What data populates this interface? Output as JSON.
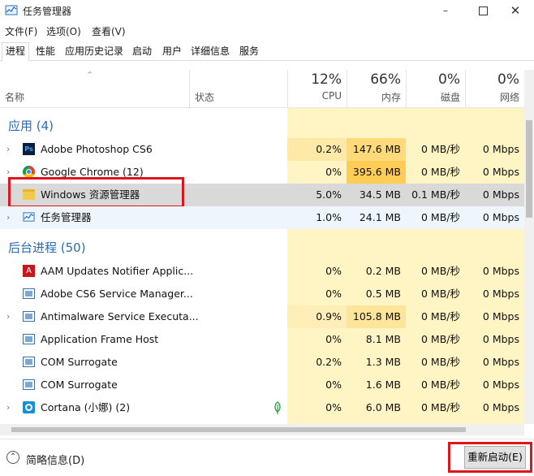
{
  "window": {
    "title": "任务管理器"
  },
  "menu": [
    "文件(F)",
    "选项(O)",
    "查看(V)"
  ],
  "tabs": [
    "进程",
    "性能",
    "应用历史记录",
    "启动",
    "用户",
    "详细信息",
    "服务"
  ],
  "columns": {
    "name": "名称",
    "status": "状态",
    "cpu": {
      "pct": "12%",
      "label": "CPU"
    },
    "memory": {
      "pct": "66%",
      "label": "内存"
    },
    "disk": {
      "pct": "0%",
      "label": "磁盘"
    },
    "network": {
      "pct": "0%",
      "label": "网络"
    }
  },
  "groups": {
    "apps": "应用 (4)",
    "background": "后台进程 (50)"
  },
  "apps": [
    {
      "name": "Adobe Photoshop CS6",
      "cpu": "0.2%",
      "mem": "147.6 MB",
      "disk": "0 MB/秒",
      "net": "0 Mbps"
    },
    {
      "name": "Google Chrome (12)",
      "cpu": "0%",
      "mem": "395.6 MB",
      "disk": "0 MB/秒",
      "net": "0 Mbps"
    },
    {
      "name": "Windows 资源管理器",
      "cpu": "5.0%",
      "mem": "34.5 MB",
      "disk": "0.1 MB/秒",
      "net": "0 Mbps"
    },
    {
      "name": "任务管理器",
      "cpu": "1.0%",
      "mem": "24.1 MB",
      "disk": "0 MB/秒",
      "net": "0 Mbps"
    }
  ],
  "background": [
    {
      "name": "AAM Updates Notifier Applic...",
      "cpu": "0%",
      "mem": "0.2 MB",
      "disk": "0 MB/秒",
      "net": "0 Mbps"
    },
    {
      "name": "Adobe CS6 Service Manager...",
      "cpu": "0%",
      "mem": "0.5 MB",
      "disk": "0 MB/秒",
      "net": "0 Mbps"
    },
    {
      "name": "Antimalware Service Executa...",
      "cpu": "0.9%",
      "mem": "105.8 MB",
      "disk": "0 MB/秒",
      "net": "0 Mbps"
    },
    {
      "name": "Application Frame Host",
      "cpu": "0%",
      "mem": "8.1 MB",
      "disk": "0 MB/秒",
      "net": "0 Mbps"
    },
    {
      "name": "COM Surrogate",
      "cpu": "0.2%",
      "mem": "1.3 MB",
      "disk": "0 MB/秒",
      "net": "0 Mbps"
    },
    {
      "name": "COM Surrogate",
      "cpu": "0%",
      "mem": "1.6 MB",
      "disk": "0 MB/秒",
      "net": "0 Mbps"
    },
    {
      "name": "Cortana (小娜) (2)",
      "cpu": "0%",
      "mem": "6.0 MB",
      "disk": "0 MB/秒",
      "net": "0 Mbps"
    }
  ],
  "footer": {
    "less_details": "简略信息(D)",
    "restart": "重新启动(E)"
  }
}
